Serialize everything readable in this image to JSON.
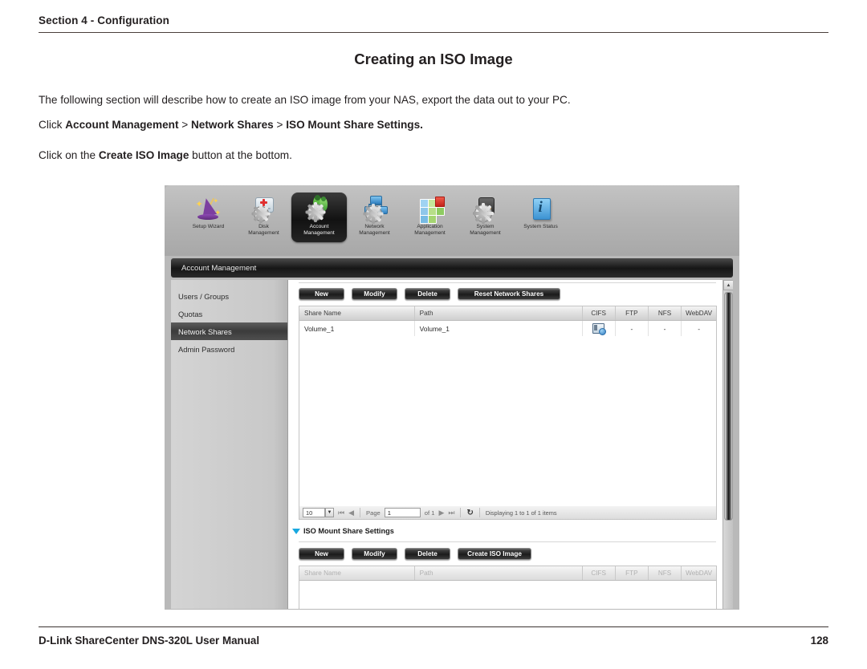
{
  "document": {
    "section_label": "Section 4 - Configuration",
    "title": "Creating an ISO Image",
    "paragraph_1": "The following section will describe how to create an ISO image from your NAS, export the data out to your PC.",
    "paragraph_2": {
      "prefix": "Click ",
      "bold_1": "Account Management",
      "sep_1": " > ",
      "bold_2": "Network Shares",
      "sep_2": " > ",
      "bold_3": "ISO Mount Share Settings."
    },
    "paragraph_3": {
      "prefix": "Click on the ",
      "bold": "Create ISO Image",
      "suffix": " button at the bottom."
    },
    "footer_left": "D-Link ShareCenter DNS-320L User Manual",
    "footer_page": "128"
  },
  "screenshot": {
    "navbar": {
      "items": [
        {
          "label_line1": "Setup Wizard",
          "label_line2": "",
          "icon": "wizard-icon",
          "active": false
        },
        {
          "label_line1": "Disk",
          "label_line2": "Management",
          "icon": "disk-gear-icon",
          "active": false
        },
        {
          "label_line1": "Account",
          "label_line2": "Management",
          "icon": "users-gear-icon",
          "active": true
        },
        {
          "label_line1": "Network",
          "label_line2": "Management",
          "icon": "network-gear-icon",
          "active": false
        },
        {
          "label_line1": "Application",
          "label_line2": "Management",
          "icon": "app-tiles-icon",
          "active": false
        },
        {
          "label_line1": "System",
          "label_line2": "Management",
          "icon": "system-gear-icon",
          "active": false
        },
        {
          "label_line1": "System Status",
          "label_line2": "",
          "icon": "info-book-icon",
          "active": false
        }
      ]
    },
    "titlebar": "Account Management",
    "sidebar": {
      "items": [
        {
          "label": "Users / Groups",
          "active": false
        },
        {
          "label": "Quotas",
          "active": false
        },
        {
          "label": "Network Shares",
          "active": true
        },
        {
          "label": "Admin Password",
          "active": false
        }
      ]
    },
    "network_shares": {
      "buttons": [
        {
          "label": "New"
        },
        {
          "label": "Modify"
        },
        {
          "label": "Delete"
        },
        {
          "label": "Reset Network Shares"
        }
      ],
      "columns": [
        "Share Name",
        "Path",
        "CIFS",
        "FTP",
        "NFS",
        "WebDAV"
      ],
      "rows": [
        {
          "share_name": "Volume_1",
          "path": "Volume_1",
          "cifs": "cifs-share-icon",
          "ftp": "-",
          "nfs": "-",
          "webdav": "-"
        }
      ],
      "pager": {
        "page_size": "10",
        "page_label": "Page",
        "page_value": "1",
        "of_label": "of 1",
        "info": "Displaying 1 to 1 of 1 items"
      }
    },
    "iso_section": {
      "heading": "ISO Mount Share Settings",
      "buttons": [
        {
          "label": "New"
        },
        {
          "label": "Modify"
        },
        {
          "label": "Delete"
        },
        {
          "label": "Create ISO Image"
        }
      ],
      "columns": [
        "Share Name",
        "Path",
        "CIFS",
        "FTP",
        "NFS",
        "WebDAV"
      ],
      "rows": []
    }
  },
  "colors": {
    "rule": "#4a3f3c",
    "accent_triangle": "#18a8e0",
    "active_nav_bg": "#121212",
    "text": "#231f20"
  }
}
